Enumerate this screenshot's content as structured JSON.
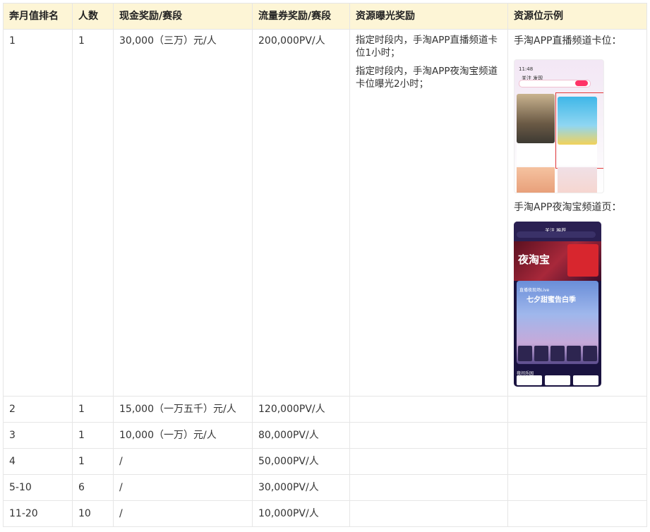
{
  "headers": [
    "奔月值排名",
    "人数",
    "现金奖励/赛段",
    "流量券奖励/赛段",
    "资源曝光奖励",
    "资源位示例"
  ],
  "rows": [
    {
      "rank": "1",
      "count": "1",
      "cash": "30,000（三万）元/人",
      "traffic": "200,000PV/人"
    },
    {
      "rank": "2",
      "count": "1",
      "cash": "15,000（一万五千）元/人",
      "traffic": "120,000PV/人"
    },
    {
      "rank": "3",
      "count": "1",
      "cash": "10,000（一万）元/人",
      "traffic": "80,000PV/人"
    },
    {
      "rank": "4",
      "count": "1",
      "cash": "/",
      "traffic": "50,000PV/人"
    },
    {
      "rank": "5-10",
      "count": "6",
      "cash": "/",
      "traffic": "30,000PV/人"
    },
    {
      "rank": "11-20",
      "count": "10",
      "cash": "/",
      "traffic": "10,000PV/人"
    }
  ],
  "exposure": [
    "指定时段内，手淘APP直播频道卡位1小时；",
    "指定时段内，手淘APP夜淘宝频道卡位曝光2小时；"
  ],
  "examples": {
    "caption1": "手淘APP直播频道卡位：",
    "caption2": "手淘APP夜淘宝频道页：",
    "phone1": {
      "time": "11:48",
      "tabs": "关注  发现"
    },
    "phone2": {
      "tabs": "关注  推荐",
      "banner": "夜淘宝",
      "live_label": "直播夜现场Live",
      "qixi": "七夕甜蜜告白季",
      "section": "夜间乐园"
    }
  }
}
